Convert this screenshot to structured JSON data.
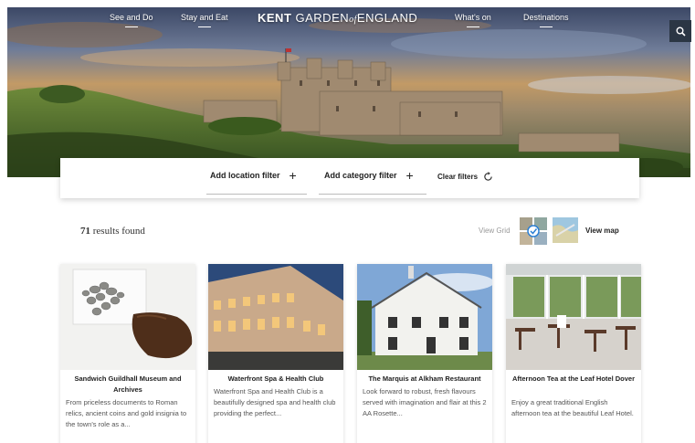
{
  "nav": {
    "links": [
      {
        "label": "See and Do"
      },
      {
        "label": "Stay and Eat"
      },
      {
        "label": "What's on"
      },
      {
        "label": "Destinations"
      }
    ],
    "logo": {
      "part1": "KENT",
      "part2": "GARDEN",
      "part3": "of",
      "part4": "ENGLAND"
    },
    "search_icon": "search-icon"
  },
  "filters": {
    "location_label": "Add location filter",
    "category_label": "Add category filter",
    "plus_glyph": "+",
    "clear_label": "Clear filters",
    "clear_icon": "refresh-icon"
  },
  "results": {
    "count": "71",
    "count_suffix": "results found",
    "view_grid_label": "View Grid",
    "view_map_label": "View map"
  },
  "cards": [
    {
      "title": "Sandwich Guildhall Museum and Archives",
      "description": "From priceless documents to Roman relics, ancient coins and gold insignia to the town's role as a..."
    },
    {
      "title": "Waterfront Spa & Health Club",
      "description": "Waterfront Spa and Health Club is a beautifully designed spa and health club providing the perfect..."
    },
    {
      "title": "The Marquis at Alkham Restaurant",
      "description": "Look forward to robust, fresh flavours served with imagination and flair at this 2 AA Rosette..."
    },
    {
      "title": "Afternoon Tea at the Leaf Hotel Dover",
      "description": "Enjoy a great traditional English afternoon tea at the beautiful Leaf Hotel."
    }
  ],
  "colors": {
    "search_button_bg": "#2b3644",
    "accent_check": "#2a7fd4"
  }
}
